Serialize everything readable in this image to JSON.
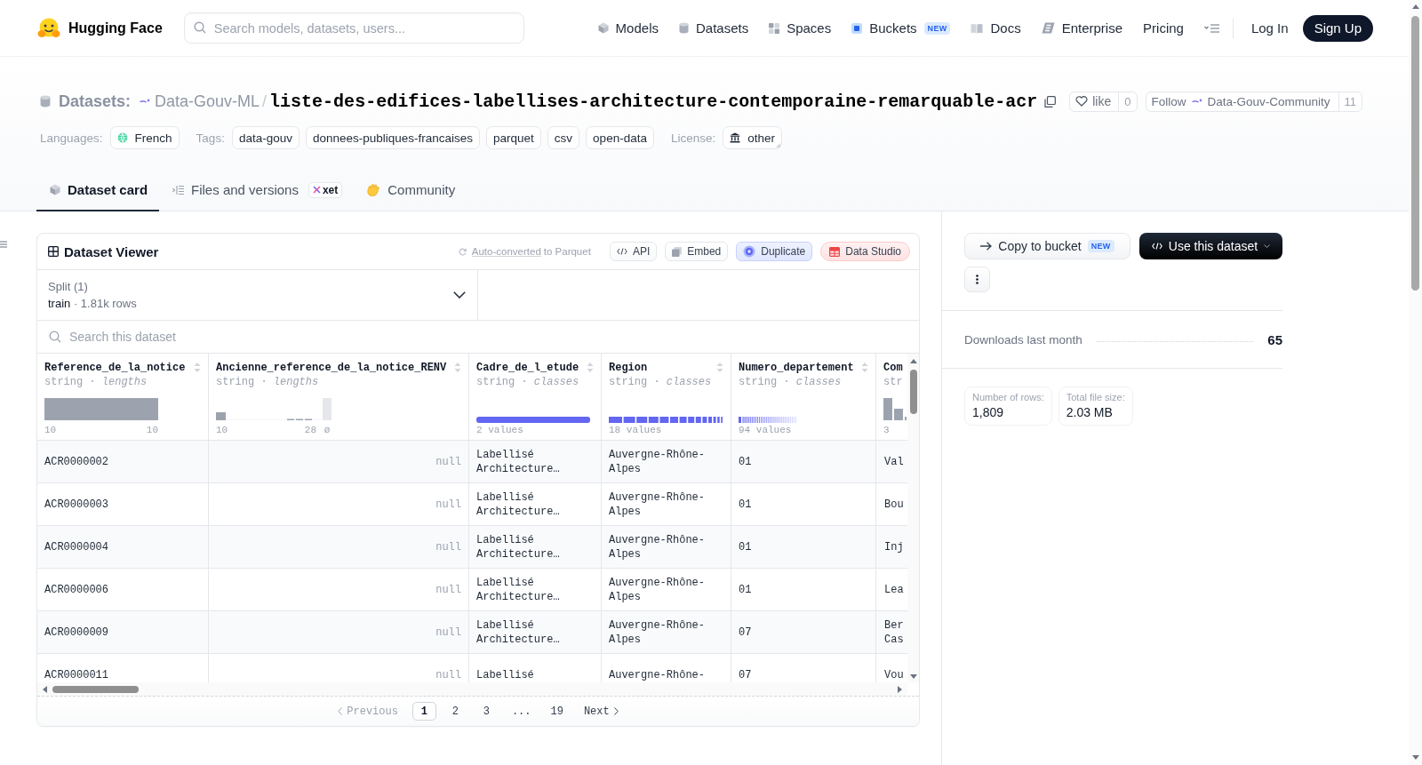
{
  "header": {
    "brand": "Hugging Face",
    "search": {
      "placeholder": "Search models, datasets, users..."
    },
    "nav": [
      {
        "label": "Models"
      },
      {
        "label": "Datasets"
      },
      {
        "label": "Spaces"
      },
      {
        "label": "Buckets",
        "badge": "NEW"
      },
      {
        "label": "Docs"
      },
      {
        "label": "Enterprise"
      },
      {
        "label": "Pricing"
      }
    ],
    "login": "Log In",
    "signup": "Sign Up"
  },
  "repo": {
    "type_label": "Datasets:",
    "owner": "Data-Gouv-ML",
    "separator": "/",
    "name": "liste-des-edifices-labellises-architecture-contemporaine-remarquable-acr",
    "like": {
      "label": "like",
      "count": "0"
    },
    "follow": {
      "label": "Follow",
      "org": "Data-Gouv-Community",
      "count": "11"
    },
    "meta": [
      {
        "label": "Languages:",
        "chips": [
          {
            "text": "French",
            "kind": "language"
          }
        ]
      },
      {
        "label": "Tags:",
        "chips": [
          {
            "text": "data-gouv",
            "kind": "tag"
          },
          {
            "text": "donnees-publiques-francaises",
            "kind": "tag"
          },
          {
            "text": "parquet",
            "kind": "tag"
          },
          {
            "text": "csv",
            "kind": "tag"
          },
          {
            "text": "open-data",
            "kind": "tag"
          }
        ]
      },
      {
        "label": "License:",
        "chips": [
          {
            "text": "other",
            "kind": "license"
          }
        ]
      }
    ]
  },
  "tabs": [
    {
      "label": "Dataset card",
      "selected": true
    },
    {
      "label": "Files and versions",
      "badge": "xet",
      "selected": false
    },
    {
      "label": "Community",
      "selected": false
    }
  ],
  "viewer": {
    "title": "Dataset Viewer",
    "conversion": {
      "link": "Auto-converted",
      "text": "to Parquet"
    },
    "actions": [
      {
        "label": "API",
        "kind": "api"
      },
      {
        "label": "Embed",
        "kind": "embed"
      },
      {
        "label": "Duplicate",
        "kind": "duplicate"
      },
      {
        "label": "Data Studio",
        "kind": "studio"
      }
    ],
    "split": {
      "label": "Split (1)",
      "value": "train",
      "detail": "· 1.81k rows"
    },
    "search": {
      "placeholder": "Search this dataset"
    },
    "columns": [
      {
        "name": "Reference_de_la_notice",
        "type": "string · *lengths*",
        "kind": "histogram",
        "range": [
          "10",
          "10"
        ]
      },
      {
        "name": "Ancienne_reference_de_la_notice_RENV",
        "type": "string · *lengths*",
        "kind": "histogram",
        "range": [
          "10",
          "28"
        ],
        "null_label": "ø"
      },
      {
        "name": "Cadre_de_l_etude",
        "type": "string · *classes*",
        "kind": "classes",
        "summary": "2 values"
      },
      {
        "name": "Region",
        "type": "string · *classes*",
        "kind": "classes",
        "summary": "18 values"
      },
      {
        "name": "Numero_departement",
        "type": "string · *classes*",
        "kind": "classes",
        "summary": "94 values"
      },
      {
        "name": "Com",
        "type": "str",
        "kind": "histogram",
        "range": [
          "3"
        ]
      }
    ],
    "rows": [
      {
        "cells": [
          {
            "text": "ACR0000002",
            "null": false
          },
          {
            "text": "null",
            "null": true
          },
          {
            "text": "Labellisé Architecture…",
            "null": false
          },
          {
            "text": "Auvergne-Rhône-Alpes",
            "null": false
          },
          {
            "text": "01",
            "null": false
          },
          {
            "text": "Val",
            "null": false
          }
        ]
      },
      {
        "cells": [
          {
            "text": "ACR0000003",
            "null": false
          },
          {
            "text": "null",
            "null": true
          },
          {
            "text": "Labellisé Architecture…",
            "null": false
          },
          {
            "text": "Auvergne-Rhône-Alpes",
            "null": false
          },
          {
            "text": "01",
            "null": false
          },
          {
            "text": "Bou",
            "null": false
          }
        ]
      },
      {
        "cells": [
          {
            "text": "ACR0000004",
            "null": false
          },
          {
            "text": "null",
            "null": true
          },
          {
            "text": "Labellisé Architecture…",
            "null": false
          },
          {
            "text": "Auvergne-Rhône-Alpes",
            "null": false
          },
          {
            "text": "01",
            "null": false
          },
          {
            "text": "Inj",
            "null": false
          }
        ]
      },
      {
        "cells": [
          {
            "text": "ACR0000006",
            "null": false
          },
          {
            "text": "null",
            "null": true
          },
          {
            "text": "Labellisé Architecture…",
            "null": false
          },
          {
            "text": "Auvergne-Rhône-Alpes",
            "null": false
          },
          {
            "text": "01",
            "null": false
          },
          {
            "text": "Lea",
            "null": false
          }
        ]
      },
      {
        "cells": [
          {
            "text": "ACR0000009",
            "null": false
          },
          {
            "text": "null",
            "null": true
          },
          {
            "text": "Labellisé Architecture…",
            "null": false
          },
          {
            "text": "Auvergne-Rhône-Alpes",
            "null": false
          },
          {
            "text": "07",
            "null": false
          },
          {
            "text": "Ber Cas",
            "null": false
          }
        ]
      },
      {
        "cells": [
          {
            "text": "ACR0000011",
            "null": false
          },
          {
            "text": "null",
            "null": true
          },
          {
            "text": "Labellisé",
            "null": false
          },
          {
            "text": "Auvergne-Rhône-",
            "null": false
          },
          {
            "text": "07",
            "null": false
          },
          {
            "text": "Vou",
            "null": false
          }
        ]
      }
    ],
    "pagination": {
      "previous": {
        "label": "Previous",
        "disabled": true
      },
      "pages": [
        {
          "label": "1",
          "selected": true
        },
        {
          "label": "2",
          "selected": false
        },
        {
          "label": "3",
          "selected": false
        },
        {
          "label": "...",
          "selected": false
        },
        {
          "label": "19",
          "selected": false
        }
      ],
      "next": {
        "label": "Next",
        "disabled": false
      }
    }
  },
  "sidebar": {
    "actions": [
      {
        "label": "Copy to bucket",
        "badge": "NEW",
        "kind": "secondary"
      },
      {
        "label": "Use this dataset",
        "kind": "primary"
      }
    ],
    "downloads": {
      "label": "Downloads last month",
      "value": "65"
    },
    "stats": [
      {
        "label": "Number of rows:",
        "value": "1,809"
      },
      {
        "label": "Total file size:",
        "value": "2.03 MB"
      }
    ]
  }
}
